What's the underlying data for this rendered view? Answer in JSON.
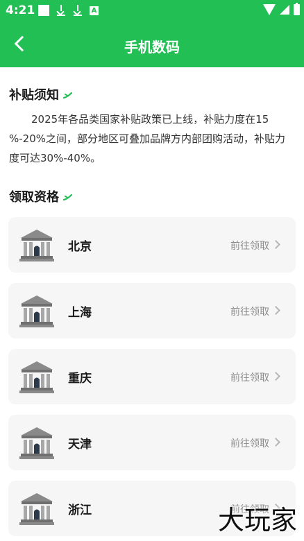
{
  "status_bar": {
    "time": "4:21"
  },
  "header": {
    "title": "手机数码"
  },
  "notice": {
    "title": "补贴须知",
    "body": "2025年各品类国家补贴政策已上线，补贴力度在15 %-20%之间，部分地区可叠加品牌方内部团购活动，补贴力度可达30%-40%。"
  },
  "eligibility": {
    "title": "领取资格",
    "items": [
      {
        "name": "北京",
        "action": "前往领取"
      },
      {
        "name": "上海",
        "action": "前往领取"
      },
      {
        "name": "重庆",
        "action": "前往领取"
      },
      {
        "name": "天津",
        "action": "前往领取"
      },
      {
        "name": "浙江",
        "action": "前往领取"
      }
    ]
  },
  "watermark": "大玩家",
  "colors": {
    "brand": "#22bf55",
    "card_bg": "#f6f6f6"
  }
}
